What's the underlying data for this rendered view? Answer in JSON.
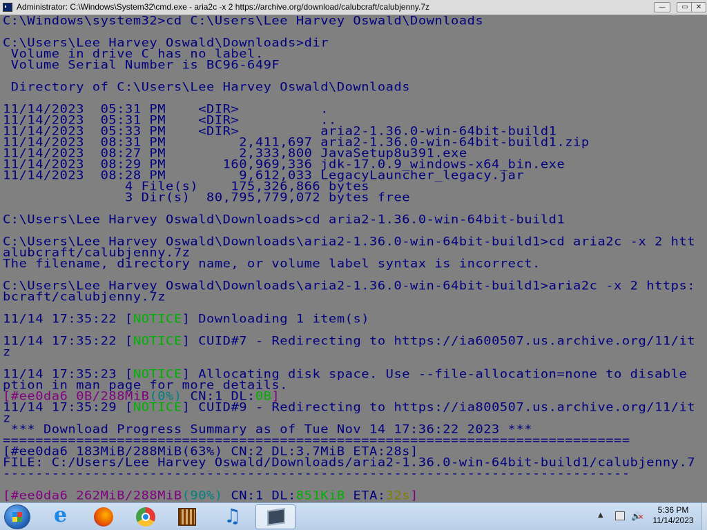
{
  "window": {
    "title": "Administrator: C:\\Windows\\System32\\cmd.exe - aria2c  -x 2 https://archive.org/download/calubcraft/calubjenny.7z",
    "minimize": "—",
    "maximize": "▭",
    "close": "✕"
  },
  "console": {
    "l1": "C:\\Windows\\system32>cd C:\\Users\\Lee Harvey Oswald\\Downloads",
    "l2": "C:\\Users\\Lee Harvey Oswald\\Downloads>dir",
    "l3": " Volume in drive C has no label.",
    "l4": " Volume Serial Number is BC96-649F",
    "l5": " Directory of C:\\Users\\Lee Harvey Oswald\\Downloads",
    "dir_rows": [
      "11/14/2023  05:31 PM    <DIR>          .",
      "11/14/2023  05:31 PM    <DIR>          ..",
      "11/14/2023  05:33 PM    <DIR>          aria2-1.36.0-win-64bit-build1",
      "11/14/2023  08:31 PM         2,411,697 aria2-1.36.0-win-64bit-build1.zip",
      "11/14/2023  08:27 PM         2,333,800 JavaSetup8u391.exe",
      "11/14/2023  08:29 PM       160,969,336 jdk-17.0.9_windows-x64_bin.exe",
      "11/14/2023  08:28 PM         9,612,033 LegacyLauncher_legacy.jar",
      "               4 File(s)    175,326,866 bytes",
      "               3 Dir(s)  80,795,779,072 bytes free"
    ],
    "l6": "C:\\Users\\Lee Harvey Oswald\\Downloads>cd aria2-1.36.0-win-64bit-build1",
    "l7": "C:\\Users\\Lee Harvey Oswald\\Downloads\\aria2-1.36.0-win-64bit-build1>cd aria2c -x 2 htt",
    "l8": "alubcraft/calubjenny.7z",
    "l9": "The filename, directory name, or volume label syntax is incorrect.",
    "l10": "C:\\Users\\Lee Harvey Oswald\\Downloads\\aria2-1.36.0-win-64bit-build1>aria2c -x 2 https:",
    "l11": "bcraft/calubjenny.7z",
    "n1_time": "11/14 17:35:22 [",
    "notice": "NOTICE",
    "n1_msg": "] Downloading 1 item(s)",
    "n2_time": "11/14 17:35:22 [",
    "n2_msg": "] CUID#7 - Redirecting to https://ia600507.us.archive.org/11/it",
    "z1": "z",
    "n3_time": "11/14 17:35:23 [",
    "n3_msg": "] Allocating disk space. Use --file-allocation=none to disable",
    "n3_cont": "ption in man page for more details.",
    "p1_a": "[#ee0da6 0B/288MiB",
    "p1_pct": "(0%)",
    "p1_b": " CN:1 DL:",
    "p1_dl": "0B",
    "p1_c": "]",
    "n4_time": "11/14 17:35:29 [",
    "n4_msg": "] CUID#9 - Redirecting to https://ia800507.us.archive.org/11/it",
    "z2": "z",
    "summary": " *** Download Progress Summary as of Tue Nov 14 17:36:22 2023 ***",
    "rule_eq": "=============================================================================",
    "p2": "[#ee0da6 183MiB/288MiB(63%) CN:2 DL:3.7MiB ETA:28s]",
    "file": "FILE: C:/Users/Lee Harvey Oswald/Downloads/aria2-1.36.0-win-64bit-build1/calubjenny.7",
    "rule_dash": "-----------------------------------------------------------------------------",
    "p3_a": "[#ee0da6 262MiB/288MiB",
    "p3_pct": "(90%)",
    "p3_b": " CN:1 DL:",
    "p3_dl": "851KiB",
    "p3_c": " ETA:",
    "p3_eta": "32s",
    "p3_d": "]"
  },
  "taskbar": {
    "clock_time": "5:36 PM",
    "clock_date": "11/14/2023",
    "tray_arrow": "▲",
    "volume": "🔊"
  },
  "colors": {
    "console_bg": "#808080",
    "console_text": "#000080",
    "notice": "#00b000",
    "progress_bracket": "#800080"
  }
}
